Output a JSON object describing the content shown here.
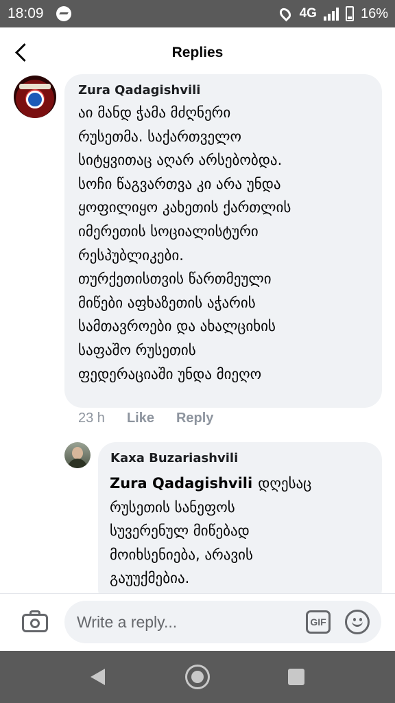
{
  "status_bar": {
    "time": "18:09",
    "network": "4G",
    "battery": "16%",
    "icons": [
      "messenger-icon",
      "location-icon",
      "signal-icon",
      "battery-icon"
    ]
  },
  "header": {
    "title": "Replies",
    "back_icon": "chevron-left-icon"
  },
  "comments": [
    {
      "author": "Zura Qadagishvili",
      "lines": [
        "აი მანდ ჭამა მძღნერი",
        "რუსეთმა. საქართველო",
        "სიტყვითაც აღარ არსებობდა.",
        "სოჩი წაგვართვა კი არა უნდა",
        "ყოფილიყო კახეთის ქართლის",
        "იმერეთის სოციალისტური",
        "რესპუბლიკები.",
        "თურქეთისთვის წართმეული",
        "მიწები აფხაზეთის აჭარის",
        "სამთავროები და ახალციხის",
        "საფაშო რუსეთის",
        "ფედერაციაში უნდა მიეღო"
      ],
      "time": "23 h",
      "like_label": "Like",
      "reply_label": "Reply"
    },
    {
      "author": "Kaxa Buzariashvili",
      "mention": "Zura Qadagishvili",
      "lines": [
        "დღესაც",
        "რუსეთის სანეფოს",
        "სუვერენულ მიწებად",
        "მოიხსენიება, არავის",
        "გაუუქმებია."
      ]
    }
  ],
  "composer": {
    "placeholder": "Write a reply...",
    "gif_label": "GIF",
    "icons": [
      "camera-icon",
      "gif-icon",
      "emoji-icon"
    ]
  },
  "nav_bar": {
    "icons": [
      "back-triangle-icon",
      "home-circle-icon",
      "recents-square-icon"
    ]
  },
  "colors": {
    "bubble": "#f0f2f5",
    "meta_text": "#8d949e",
    "system_bar": "#5a5a5a"
  }
}
